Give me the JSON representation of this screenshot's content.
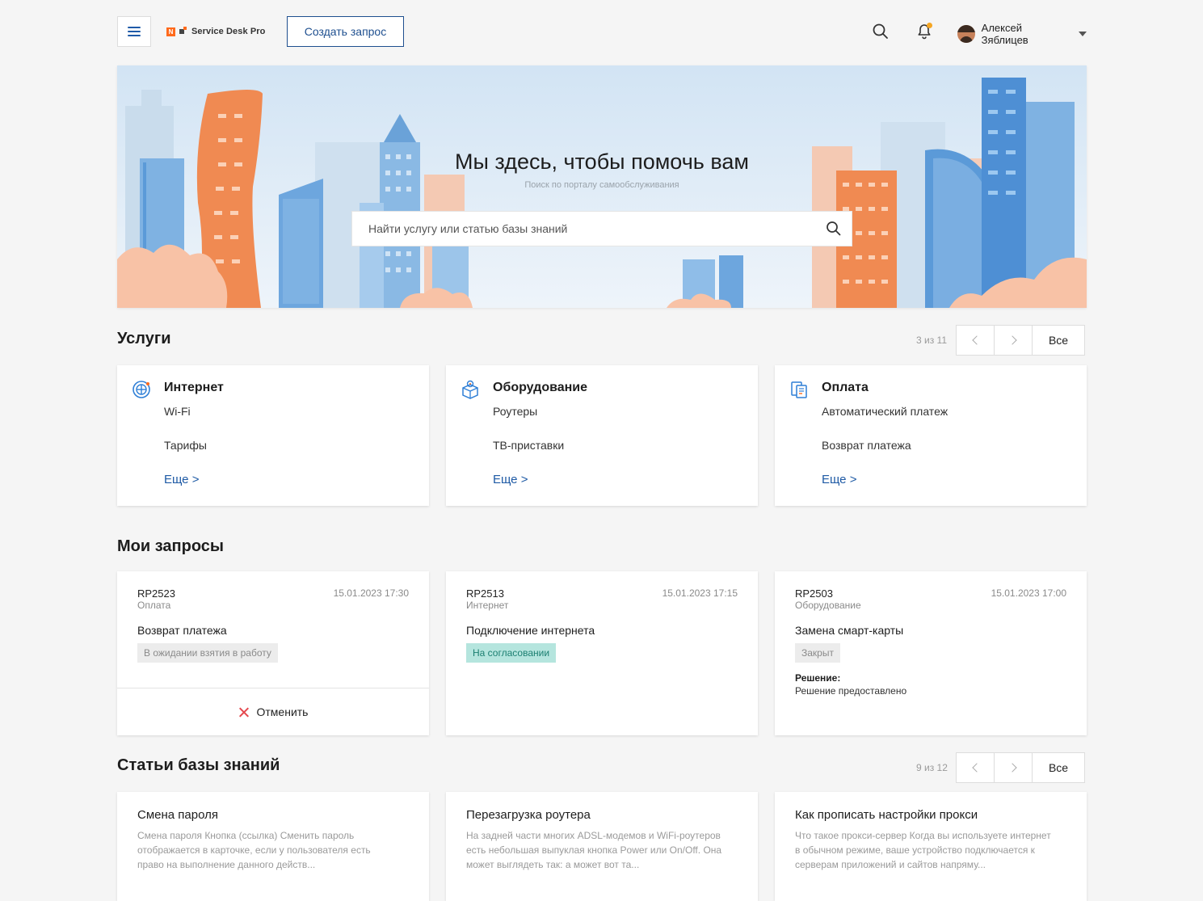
{
  "header": {
    "logo_text": "Service Desk Pro",
    "logo_mark": "N",
    "create_button": "Создать запрос",
    "user_name": "Алексей Зяблицев",
    "icons": [
      "menu-icon",
      "search-icon",
      "bell-icon",
      "avatar",
      "chevron-down-icon"
    ],
    "notification_dot_color": "#f5a623"
  },
  "hero": {
    "title": "Мы здесь, чтобы помочь вам",
    "subtitle": "Поиск по порталу самообслуживания",
    "search_placeholder": "Найти услугу или статью базы знаний"
  },
  "services": {
    "title": "Услуги",
    "counter": "3 из 11",
    "all_button": "Все",
    "cards": [
      {
        "title": "Интернет",
        "icon": "globe-icon",
        "links": [
          "Wi-Fi",
          "Тарифы"
        ],
        "more": "Еще >"
      },
      {
        "title": "Оборудование",
        "icon": "box-gear-icon",
        "links": [
          "Роутеры",
          "ТВ-приставки"
        ],
        "more": "Еще >"
      },
      {
        "title": "Оплата",
        "icon": "documents-icon",
        "links": [
          "Автоматический платеж",
          "Возврат платежа"
        ],
        "more": "Еще >"
      }
    ]
  },
  "requests": {
    "title": "Мои запросы",
    "cards": [
      {
        "id": "RP2523",
        "category": "Оплата",
        "date": "15.01.2023 17:30",
        "title": "Возврат платежа",
        "status": "В ожидании взятия в работу",
        "action": "Отменить"
      },
      {
        "id": "RP2513",
        "category": "Интернет",
        "date": "15.01.2023 17:15",
        "title": "Подключение интернета",
        "status": "На согласовании"
      },
      {
        "id": "RP2503",
        "category": "Оборудование",
        "date": "15.01.2023 17:00",
        "title": "Замена смарт-карты",
        "status": "Закрыт",
        "solution_label": "Решение:",
        "solution_text": "Решение предоставлено"
      }
    ]
  },
  "knowledge": {
    "title": "Статьи базы знаний",
    "counter": "9 из 12",
    "all_button": "Все",
    "cards": [
      {
        "title": "Смена пароля",
        "text": "Смена пароля Кнопка (ссылка) Сменить пароль отображается в карточке, если у пользователя есть право на выполнение данного действ..."
      },
      {
        "title": "Перезагрузка роутера",
        "text": "На задней части многих ADSL-модемов и WiFi-роутеров есть небольшая выпуклая кнопка Power или On/Off. Она может выглядеть так: а может вот та..."
      },
      {
        "title": "Как прописать настройки прокси",
        "text": "Что такое прокси-сервер Когда вы используете интернет в обычном режиме, ваше устройство подключается к серверам приложений и сайтов напряму..."
      }
    ]
  },
  "colors": {
    "accent_blue": "#1e5aa5",
    "brand_orange": "#ff6a1c",
    "cancel_red": "#e5484d",
    "status_teal_bg": "#b5e5de",
    "status_grey_bg": "#ececec"
  }
}
